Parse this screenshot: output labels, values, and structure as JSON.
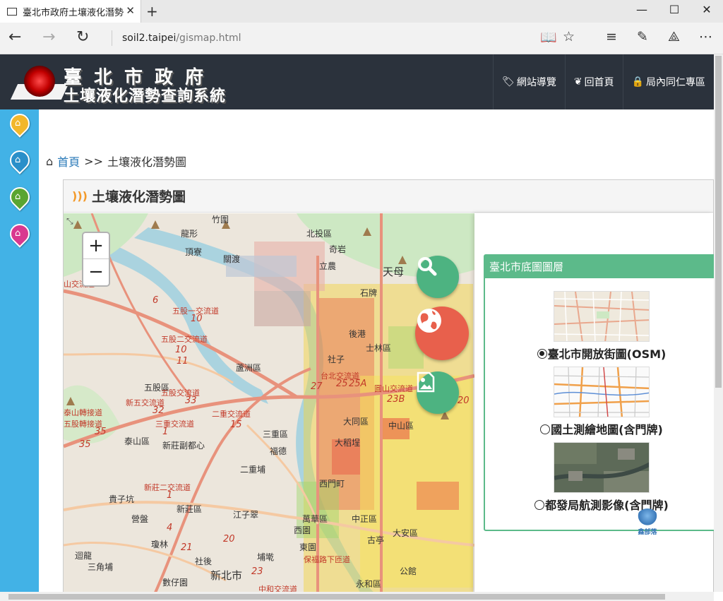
{
  "browser": {
    "tab_title": "臺北市政府土壤液化潛勢",
    "url_domain": "soil2.taipei",
    "url_path": "/gismap.html"
  },
  "header": {
    "logo_line1": "臺北市政府",
    "logo_line2": "土壤液化潛勢查詢系統",
    "nav": [
      {
        "icon": "tag-icon",
        "label": "網站導覽"
      },
      {
        "icon": "leaf-icon",
        "label": "回首頁"
      },
      {
        "icon": "lock-icon",
        "label": "局內同仁專區"
      }
    ]
  },
  "sidebar": {
    "pins": [
      {
        "name": "home-pin-yellow",
        "color": "#f2b72b"
      },
      {
        "name": "home-pin-blue",
        "color": "#2a8fc9"
      },
      {
        "name": "home-pin-green",
        "color": "#5aa531"
      },
      {
        "name": "home-pin-pink",
        "color": "#d9388f"
      }
    ]
  },
  "breadcrumb": {
    "home": "首頁",
    "separator": ">>",
    "current": "土壤液化潛勢圖"
  },
  "panel": {
    "title": "土壤液化潛勢圖"
  },
  "map": {
    "zoom_in": "+",
    "zoom_out": "−",
    "labels": {
      "zhuwei": "竹圍",
      "longxing": "龍形",
      "dingliao": "頂寮",
      "guandu": "關渡",
      "beitou_dist": "北投區",
      "qiyan": "奇岩",
      "lidong": "立農",
      "tianmu": "天母",
      "shipai": "石牌",
      "houguang": "後港",
      "shilin_dist": "士林區",
      "shezi": "社子",
      "luzhou_dist": "蘆洲區",
      "wugu_dist": "五股區",
      "taishan_dist": "泰山區",
      "xinzhuang_new_city": "新莊副都心",
      "sanchong_dist": "三重區",
      "fude": "福德",
      "erchongpu": "二重埔",
      "datong_dist": "大同區",
      "zhongshan_dist": "中山區",
      "dadaocheng": "大稻埕",
      "ximending": "西門町",
      "wanhua_dist": "萬華區",
      "zhongzheng_dist": "中正區",
      "daan_dist": "大安區",
      "xinzhuang_dist": "新莊區",
      "jiangzicui": "江子翠",
      "guiziken": "貴子坑",
      "yingpan": "營盤",
      "guolin": "瓊林",
      "huilong": "迴龍",
      "sanjiaopu": "三角埔",
      "shehou": "社後",
      "banqiao_dist": "埔墘",
      "xinbei": "新北市",
      "shuliao": "數仔園",
      "yonghe_dist": "永和區",
      "guting": "古亭",
      "dongyuan": "東園",
      "west_park": "西園",
      "gongguan": "公館",
      "road_shanzheng": "山交流道",
      "road_wugu1": "五股一交流道",
      "road_wugu2": "五股二交流道",
      "road_wugu3": "五股交流道",
      "road_wugu_junction": "五股轉接道",
      "road_taishan": "泰山轉接道",
      "road_xinwu": "新五交流道",
      "road_erchong": "二重交流道",
      "road_sanchong": "三重交流道",
      "road_xinzhuang2": "新莊二交流道",
      "road_taibei": "台北交流道",
      "road_yuanshan": "圓山交流道",
      "road_baofu": "保福路下匝道",
      "road_zhonghe": "中和交流道",
      "n10a": "10",
      "n10b": "10",
      "n11": "11",
      "n6": "6",
      "n33": "33",
      "n32": "32",
      "n35a": "35",
      "n35b": "35",
      "n27": "27",
      "n25": "25",
      "n25a": "25A",
      "n23b": "23B",
      "n20a": "20",
      "n20b": "20",
      "n15": "15",
      "n1a": "1",
      "n1b": "1",
      "n4": "4",
      "n21": "21",
      "n23": "23"
    }
  },
  "fabs": [
    {
      "name": "search-button",
      "color": "#4db381",
      "icon": "search-icon"
    },
    {
      "name": "basemap-button",
      "color": "#e8604c",
      "icon": "globe-icon"
    },
    {
      "name": "image-layer-button",
      "color": "#4db381",
      "icon": "image-icon"
    }
  ],
  "layers": {
    "title": "臺北市底圖圖層",
    "options": [
      {
        "label": "臺北市開放街圖(OSM)",
        "selected": true
      },
      {
        "label": "國土測繪地圖(含門牌)",
        "selected": false
      },
      {
        "label": "都發局航測影像(含門牌)",
        "selected": false
      }
    ],
    "watermark": "鑫部落"
  }
}
